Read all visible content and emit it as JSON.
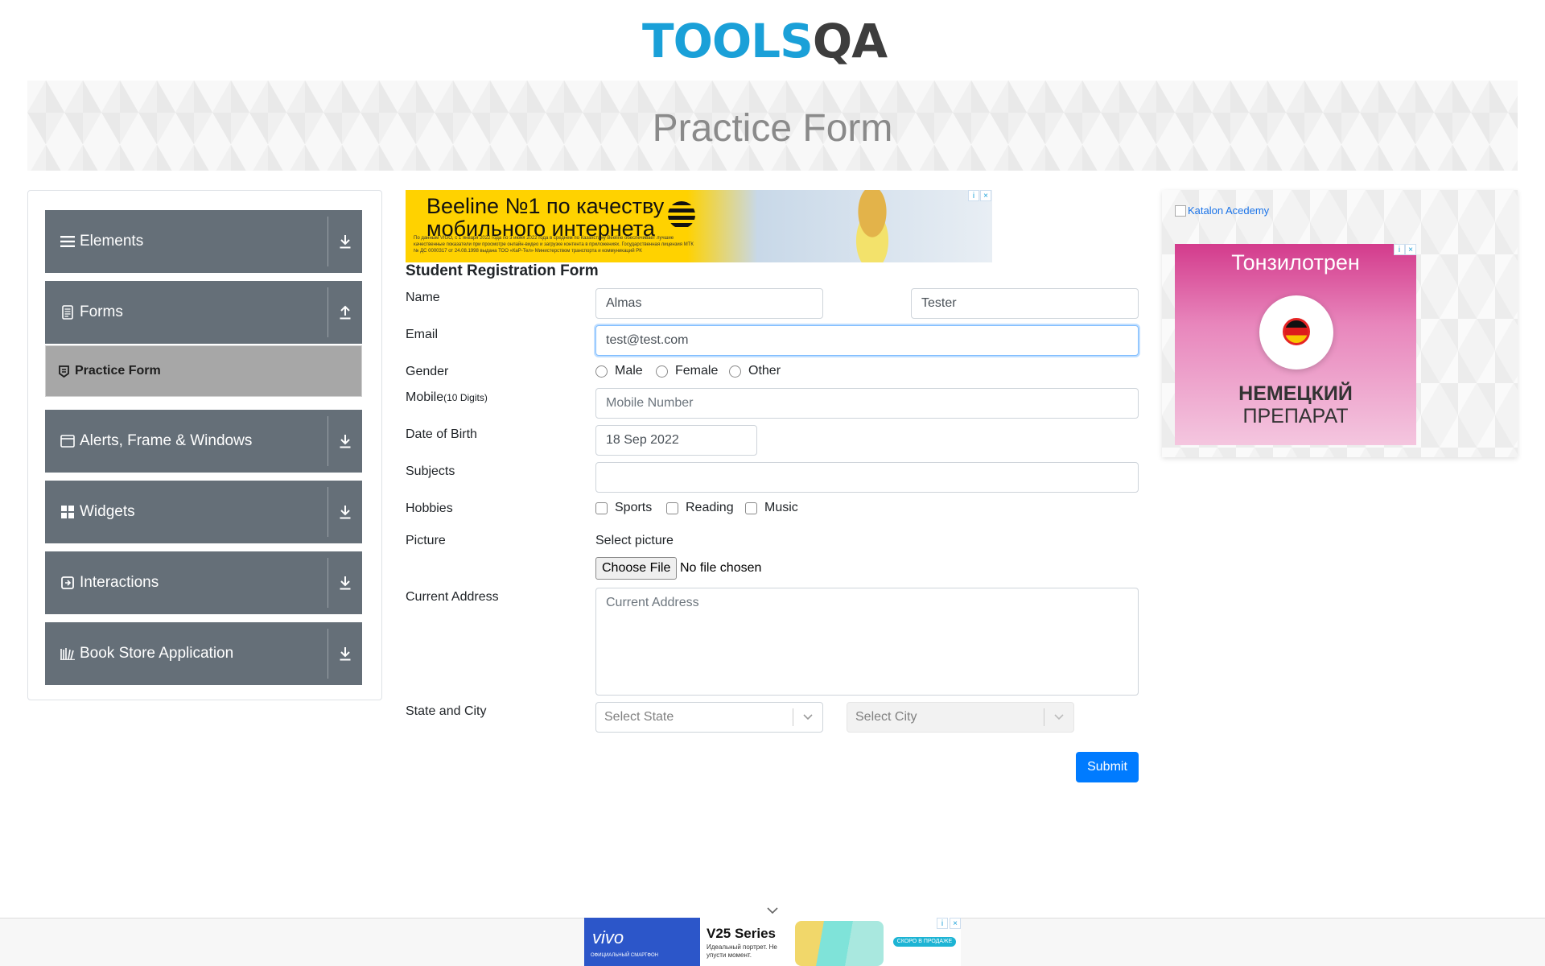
{
  "header": {
    "logo_tools": "TOOLS",
    "logo_qa": "QA"
  },
  "banner": {
    "title": "Practice Form"
  },
  "sidebar": {
    "groups": [
      {
        "label": "Elements",
        "icon": "hamburger-icon",
        "arrow": "download-arrow-icon"
      },
      {
        "label": "Forms",
        "icon": "document-icon",
        "arrow": "upload-arrow-icon"
      },
      {
        "label": "Alerts, Frame & Windows",
        "icon": "window-icon",
        "arrow": "download-arrow-icon"
      },
      {
        "label": "Widgets",
        "icon": "widgets-icon",
        "arrow": "download-arrow-icon"
      },
      {
        "label": "Interactions",
        "icon": "interactions-icon",
        "arrow": "download-arrow-icon"
      },
      {
        "label": "Book Store Application",
        "icon": "books-icon",
        "arrow": "download-arrow-icon"
      }
    ],
    "active_item": {
      "label": "Practice Form",
      "icon": "practice-form-icon"
    }
  },
  "top_ad": {
    "title_line1": "Beeline №1 по качеству",
    "title_line2": "мобильного интернета",
    "fine_print": "По данным VIGO, с 1 января 2022 года по 3 июня 2022 года в среднем по Казахстану Beeline обеспечивает лучшие качественные показатели при просмотре онлайн-видео и загрузке контента в приложениях. Государственная лицензия МТК № ДС 0000317 от 24.08.1998 выдана ТОО «КаР-Тел» Министерством транспорта и коммуникаций РК"
  },
  "form": {
    "heading": "Student Registration Form",
    "name_label": "Name",
    "first_name": "Almas",
    "last_name": "Tester",
    "email_label": "Email",
    "email": "test@test.com",
    "gender_label": "Gender",
    "gender_options": [
      "Male",
      "Female",
      "Other"
    ],
    "mobile_label": "Mobile",
    "mobile_hint": "(10 Digits)",
    "mobile_placeholder": "Mobile Number",
    "dob_label": "Date of Birth",
    "dob": "18 Sep 2022",
    "subjects_label": "Subjects",
    "hobbies_label": "Hobbies",
    "hobbies_options": [
      "Sports",
      "Reading",
      "Music"
    ],
    "picture_label": "Picture",
    "picture_caption": "Select picture",
    "choose_file": "Choose File",
    "file_status": "No file chosen",
    "address_label": "Current Address",
    "address_placeholder": "Current Address",
    "state_city_label": "State and City",
    "state_placeholder": "Select State",
    "city_placeholder": "Select City",
    "submit": "Submit"
  },
  "right_ad": {
    "katalon_alt": "Katalon Acedemy",
    "title": "Тонзилотрен",
    "line1": "НЕМЕЦКИЙ",
    "line2": "ПРЕПАРАТ"
  },
  "bottom_ad": {
    "brand": "vivo",
    "brand_sub": "ОФИЦИАЛЬНЫЙ СМАРТФОН",
    "product": "V25 Series",
    "tagline": "Идеальный портрет. Не упусти момент.",
    "cta": "СКОРО В ПРОДАЖЕ"
  },
  "colors": {
    "sidebar_group": "#656f78",
    "sidebar_active": "#a7a7a7",
    "submit": "#007bff",
    "logo_tools": "#1aa0d8",
    "logo_qa": "#3d3d3d",
    "focus_border": "#80bdff"
  }
}
